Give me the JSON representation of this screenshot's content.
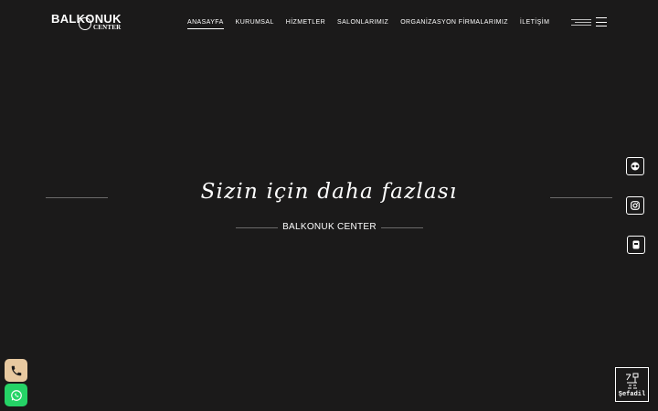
{
  "brand": {
    "name": "BALKONUK",
    "subtitle": "CENTER"
  },
  "nav": {
    "items": [
      {
        "label": "ANASAYFA",
        "active": true
      },
      {
        "label": "KURUMSAL",
        "active": false
      },
      {
        "label": "HİZMETLER",
        "active": false
      },
      {
        "label": "SALONLARIMIZ",
        "active": false
      },
      {
        "label": "ORGANİZASYON FİRMALARIMIZ",
        "active": false
      },
      {
        "label": "İLETİŞİM",
        "active": false
      }
    ]
  },
  "hero": {
    "title": "Sizin için daha fazlası",
    "subtitle": "BALKONUK CENTER"
  },
  "social": {
    "icons": [
      "tripadvisor-icon",
      "instagram-icon",
      "foursquare-icon"
    ]
  },
  "contact": {
    "phone_icon": "phone-icon",
    "whatsapp_icon": "whatsapp-icon",
    "phone_color": "#e8c9a0",
    "whatsapp_color": "#25d366"
  },
  "badge": {
    "text": "Şefadil"
  },
  "colors": {
    "background": "#1b1a1a",
    "text": "#ffffff"
  }
}
